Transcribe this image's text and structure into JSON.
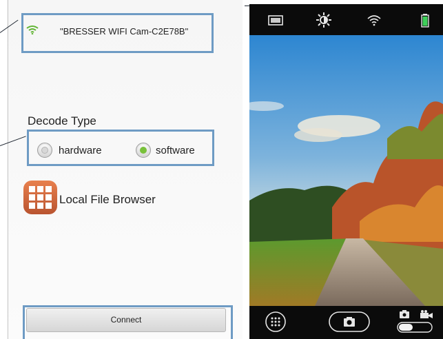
{
  "wifi": {
    "ssid": "\"BRESSER WIFI Cam-C2E78B\"",
    "icon": "wifi-icon",
    "color": "#63b536"
  },
  "decode": {
    "title": "Decode Type",
    "options": [
      {
        "label": "hardware",
        "selected": false
      },
      {
        "label": "software",
        "selected": true
      }
    ],
    "selected_color": "#78c13a"
  },
  "file_browser": {
    "label": "Local File Browser",
    "icon": "grid-icon",
    "icon_color": "#d46b3e"
  },
  "connect": {
    "label": "Connect"
  },
  "camera": {
    "status_icons": [
      "aspect-ratio-icon",
      "brightness-icon",
      "wifi-icon",
      "battery-icon"
    ],
    "bottom_icons": [
      "grid-menu-icon",
      "camera-shutter-icon",
      "photo-mode-icon",
      "video-mode-icon",
      "mode-toggle"
    ],
    "accent": "#3fcf5a"
  },
  "annotation_color": "#6e9bc4"
}
